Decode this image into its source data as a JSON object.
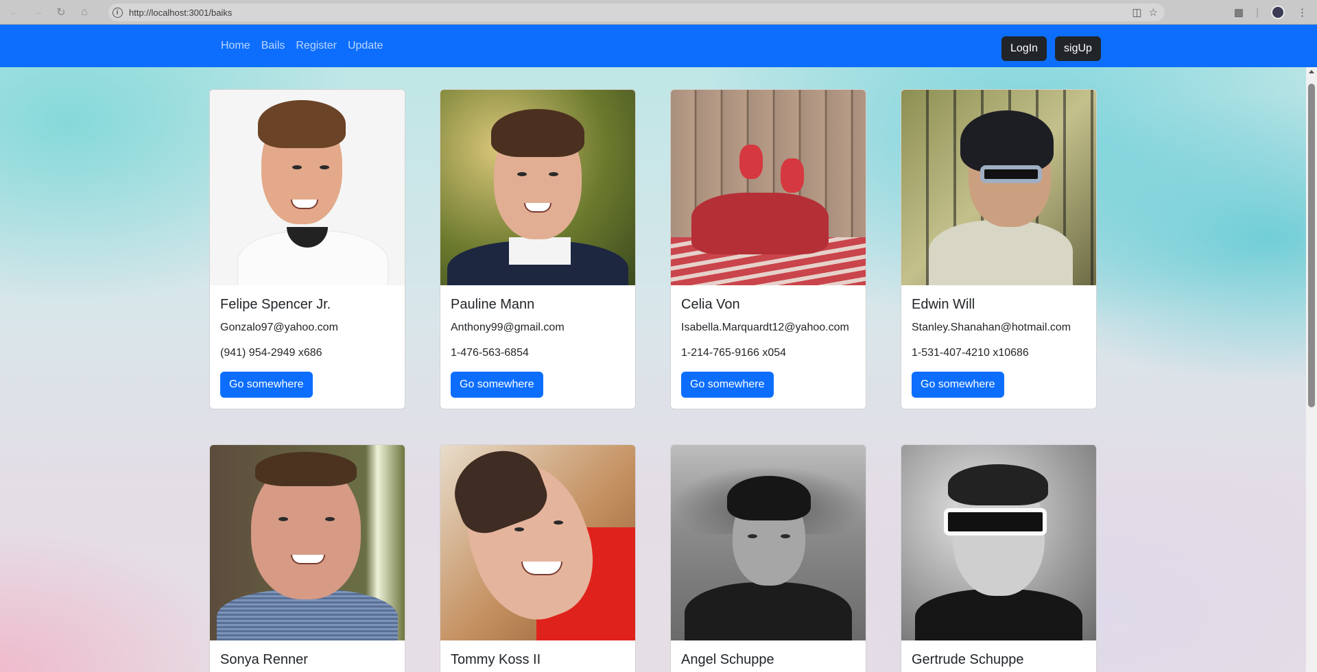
{
  "browser": {
    "url": "http://localhost:3001/baiks"
  },
  "navbar": {
    "links": [
      "Home",
      "Bails",
      "Register",
      "Update"
    ],
    "login_label": "LogIn",
    "signup_label": "sigUp"
  },
  "cards": [
    {
      "name": "Felipe Spencer Jr.",
      "email": "Gonzalo97@yahoo.com",
      "phone": "(941) 954-2949 x686",
      "button": "Go somewhere"
    },
    {
      "name": "Pauline Mann",
      "email": "Anthony99@gmail.com",
      "phone": "1-476-563-6854",
      "button": "Go somewhere"
    },
    {
      "name": "Celia Von",
      "email": "Isabella.Marquardt12@yahoo.com",
      "phone": "1-214-765-9166 x054",
      "button": "Go somewhere"
    },
    {
      "name": "Edwin Will",
      "email": "Stanley.Shanahan@hotmail.com",
      "phone": "1-531-407-4210 x10686",
      "button": "Go somewhere"
    },
    {
      "name": "Sonya Renner"
    },
    {
      "name": "Tommy Koss II"
    },
    {
      "name": "Angel Schuppe"
    },
    {
      "name": "Gertrude Schuppe"
    }
  ]
}
